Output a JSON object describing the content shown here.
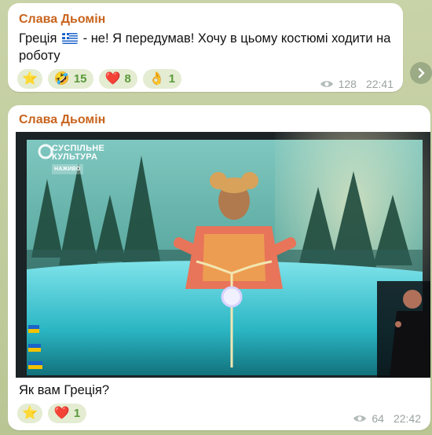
{
  "messages": [
    {
      "author": "Слава Дьомін",
      "text_before_flag": "Греція",
      "text_after_flag": "- не! Я передумав! Хочу в цьому костюмі ходити на роботу",
      "reactions": [
        {
          "emoji": "⭐",
          "count": ""
        },
        {
          "emoji": "🤣",
          "count": "15"
        },
        {
          "emoji": "❤️",
          "count": "8"
        },
        {
          "emoji": "👌",
          "count": "1"
        }
      ],
      "views": "128",
      "time": "22:41"
    },
    {
      "author": "Слава Дьомін",
      "media": {
        "logo_line1": "СУСПІЛЬНЕ",
        "logo_line2": "КУЛЬТУРА",
        "logo_live": "НАЖИВО"
      },
      "text": "Як вам Греція?",
      "reactions": [
        {
          "emoji": "⭐",
          "count": ""
        },
        {
          "emoji": "❤️",
          "count": "1"
        }
      ],
      "views": "64",
      "time": "22:42"
    }
  ],
  "colors": {
    "author": "#c8641e",
    "reaction_count": "#5a9a3a",
    "reaction_bg": "#e4ecd2",
    "meta": "#9aa3a0"
  },
  "icons": [
    "eye-icon",
    "share-icon",
    "greek-flag-icon"
  ]
}
